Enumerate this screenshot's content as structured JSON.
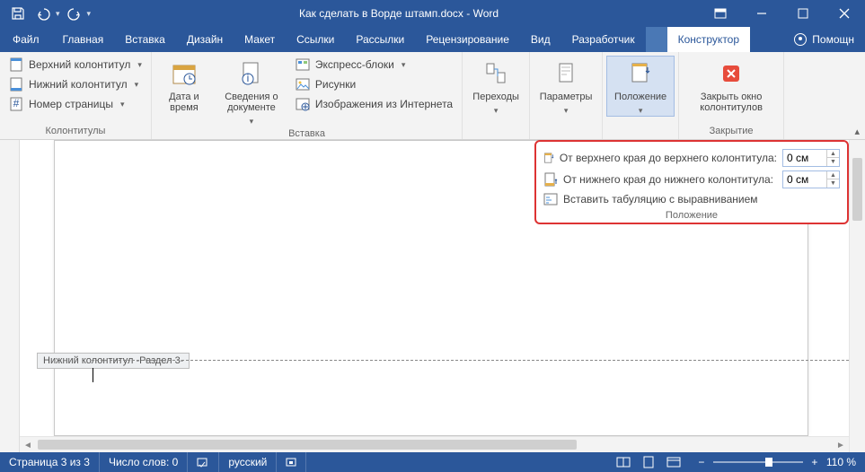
{
  "titlebar": {
    "doc_title": "Как сделать в Ворде штамп.docx - Word"
  },
  "tabs": {
    "file": "Файл",
    "home": "Главная",
    "insert": "Вставка",
    "design": "Дизайн",
    "layout": "Макет",
    "references": "Ссылки",
    "mailings": "Рассылки",
    "review": "Рецензирование",
    "view": "Вид",
    "developer": "Разработчик",
    "context_title": "",
    "constructor": "Конструктор",
    "tell_me": "Помощн"
  },
  "ribbon": {
    "hf": {
      "header": "Верхний колонтитул",
      "footer": "Нижний колонтитул",
      "page_num": "Номер страницы",
      "group_label": "Колонтитулы"
    },
    "insert": {
      "date_time": "Дата и время",
      "doc_info": "Сведения о документе",
      "quick_parts": "Экспресс-блоки",
      "pictures": "Рисунки",
      "online_pictures": "Изображения из Интернета",
      "group_label": "Вставка"
    },
    "nav": {
      "transitions": "Переходы"
    },
    "options": {
      "parameters": "Параметры"
    },
    "position": {
      "position": "Положение"
    },
    "close": {
      "close_hf": "Закрыть окно колонтитулов",
      "group_label": "Закрытие"
    }
  },
  "position_panel": {
    "from_top": "От верхнего края до верхнего колонтитула:",
    "from_bottom": "От нижнего края до нижнего колонтитула:",
    "insert_tab": "Вставить табуляцию с выравниванием",
    "top_value": "0 см",
    "bottom_value": "0 см",
    "group_label": "Положение"
  },
  "doc": {
    "footer_tag": "Нижний колонтитул -Раздел 3-"
  },
  "status": {
    "page": "Страница 3 из 3",
    "words": "Число слов: 0",
    "lang": "русский",
    "zoom": "110 %"
  }
}
